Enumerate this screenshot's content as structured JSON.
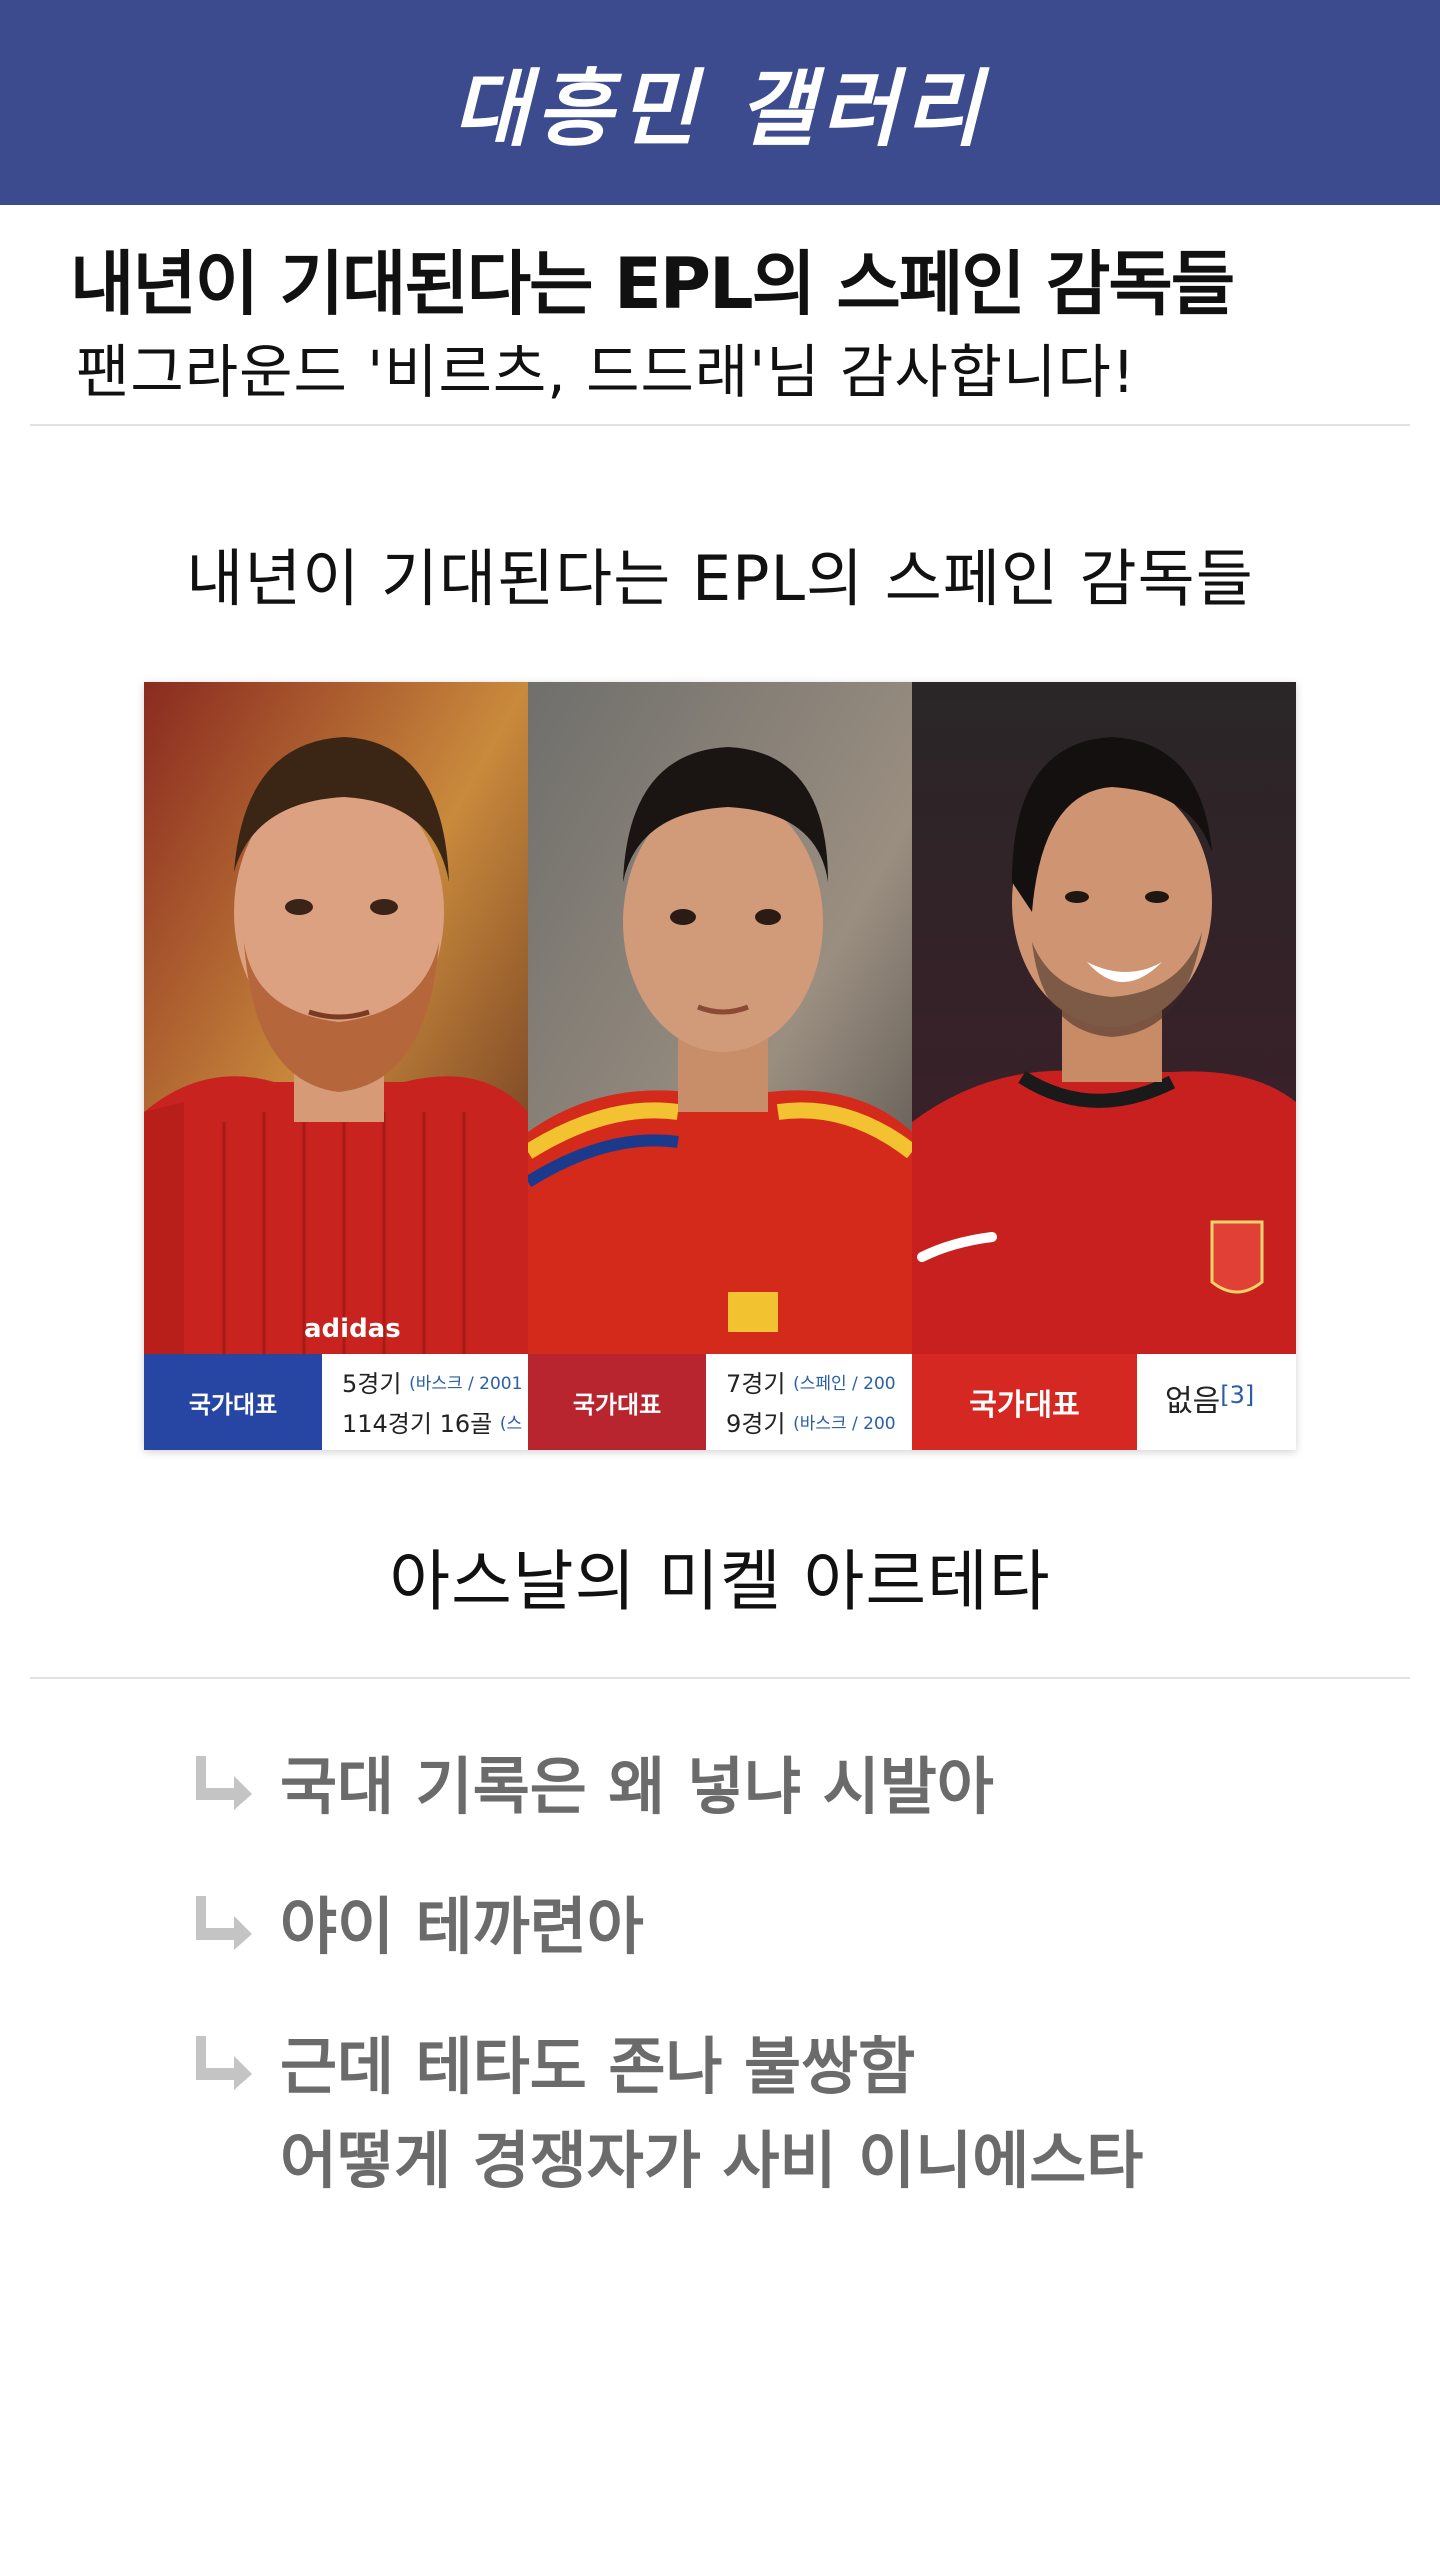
{
  "header": {
    "title": "대흥민 갤러리"
  },
  "post": {
    "title": "내년이 기대된다는 EPL의 스페인 감독들",
    "subtitle": "팬그라운드 '비르츠, 드드래'님 감사합니다!"
  },
  "body": {
    "caption_top": "내년이 기대된다는 EPL의 스페인 감독들",
    "caption_mid": "아스날의 미켈 아르테타"
  },
  "cards": [
    {
      "badge": "국가대표",
      "line1": "5경기",
      "line1_note": "(바스크 / 2001",
      "line2": "114경기 16골",
      "line2_note": "(스"
    },
    {
      "badge": "국가대표",
      "line1": "7경기",
      "line1_note": "(스페인 / 200",
      "line2": "9경기",
      "line2_note": "(바스크 / 200"
    },
    {
      "badge": "국가대표",
      "line1": "없음",
      "line1_note": "[3]"
    }
  ],
  "comments": [
    {
      "text": "국대 기록은 왜 넣냐 시발아"
    },
    {
      "text": "야이 테까련아"
    },
    {
      "text": "근데 테타도 존나 불쌍함\n어떻게 경쟁자가 사비 이니에스타"
    }
  ],
  "colors": {
    "header_bg": "#3c4a8e",
    "badge_blue": "#2746a3",
    "badge_red": "#b8252f",
    "badge_red_bright": "#d52823",
    "comment_text": "#6b6b6b"
  },
  "icons": {
    "comment_reply": "reply-arrow-icon"
  }
}
